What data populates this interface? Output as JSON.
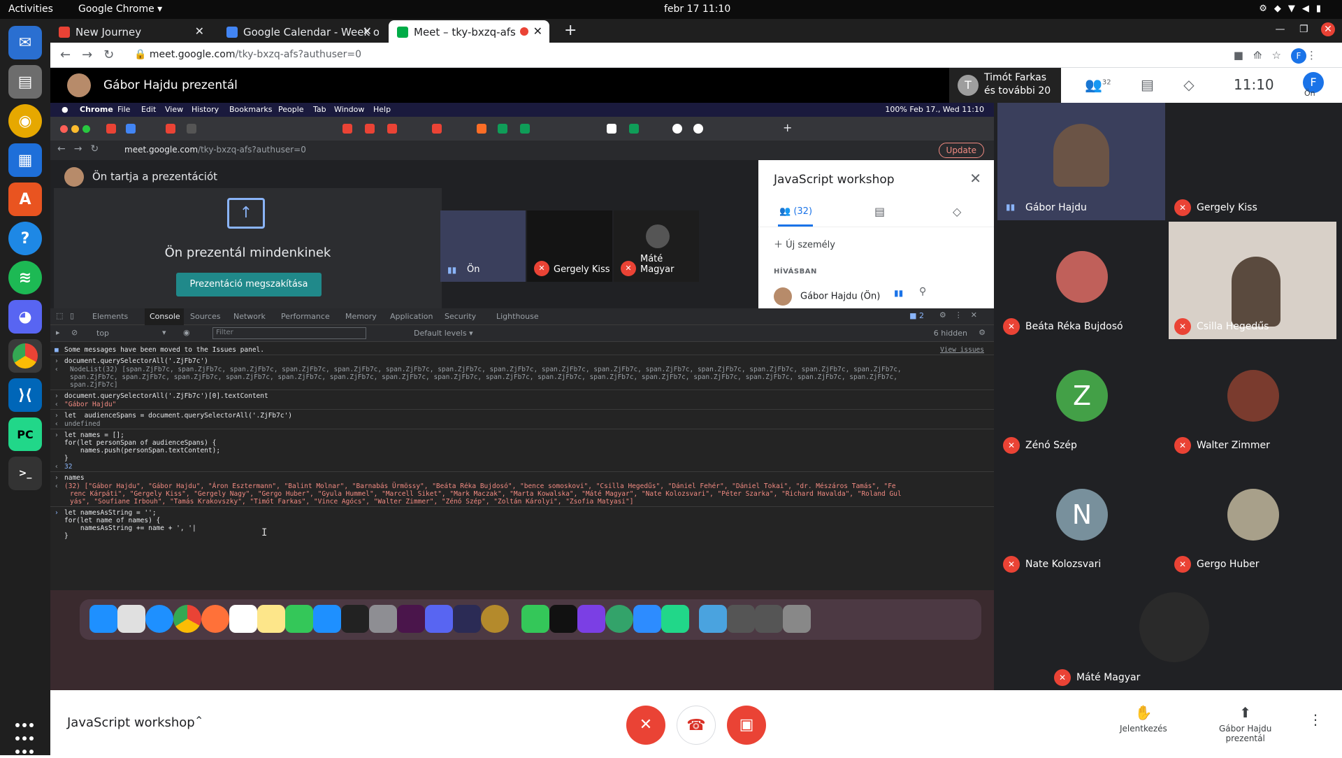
{
  "system": {
    "activities": "Activities",
    "app_name": "Google Chrome ▾",
    "clock": "febr 17  11:10"
  },
  "browser": {
    "tabs": [
      {
        "title": "New Journey",
        "favicon_color": "#e94235"
      },
      {
        "title": "Google Calendar - Week o",
        "favicon_color": "#4285f4"
      },
      {
        "title": "Meet – tky-bxzq-afs",
        "favicon_color": "#00ac47"
      }
    ],
    "url_host": "meet.google.com",
    "url_path": "/tky-bxzq-afs?authuser=0",
    "profile_initial": "F"
  },
  "meet": {
    "presenter_title": "Gábor Hajdu prezentál",
    "presenting_tile_line1": "Timót Farkas",
    "presenting_tile_line2": "és további 20",
    "tile_initial": "T",
    "people_count": "32",
    "time": "11:10",
    "self_label": "Ön",
    "self_initial": "F"
  },
  "shared_screen": {
    "mac_menu": [
      "Chrome",
      "File",
      "Edit",
      "View",
      "History",
      "Bookmarks",
      "People",
      "Tab",
      "Window",
      "Help"
    ],
    "mac_status": "100%   Feb 17., Wed  11:10",
    "inner_url_host": "meet.google.com",
    "inner_url_path": "/tky-bxzq-afs?authuser=0",
    "update_label": "Update",
    "presenting_header": "Ön tartja a prezentációt",
    "presenting_text": "Ön prezentál mindenkinek",
    "stop_button": "Prezentáció megszakítása",
    "tiles": [
      {
        "name": "Ön"
      },
      {
        "name": "Gergely Kiss"
      },
      {
        "name": "Máté Magyar"
      }
    ],
    "panel": {
      "title": "JavaScript workshop",
      "people_tab": "(32)",
      "add_person": "Új személy",
      "section": "HÍVÁSBAN",
      "person": "Gábor Hajdu (Ön)"
    }
  },
  "devtools": {
    "tabs": [
      "Elements",
      "Console",
      "Sources",
      "Network",
      "Performance",
      "Memory",
      "Application",
      "Security",
      "Lighthouse"
    ],
    "issues_count": "2",
    "context": "top",
    "filter_placeholder": "Filter",
    "levels": "Default levels ▾",
    "hidden": "6 hidden",
    "issues_msg": "Some messages have been moved to the Issues panel.",
    "view_issues": "View issues",
    "lines": [
      "document.querySelectorAll('.ZjFb7c')",
      "NodeList(32) [span.ZjFb7c, span.ZjFb7c, span.ZjFb7c, span.ZjFb7c, span.ZjFb7c, span.ZjFb7c, span.ZjFb7c, span.ZjFb7c, span.ZjFb7c, span.ZjFb7c, span.ZjFb7c, span.ZjFb7c, span.ZjFb7c, span.ZjFb7c, span.ZjFb7c,",
      "span.ZjFb7c, span.ZjFb7c, span.ZjFb7c, span.ZjFb7c, span.ZjFb7c, span.ZjFb7c, span.ZjFb7c, span.ZjFb7c, span.ZjFb7c, span.ZjFb7c, span.ZjFb7c, span.ZjFb7c, span.ZjFb7c, span.ZjFb7c, span.ZjFb7c, span.ZjFb7c,",
      "span.ZjFb7c]",
      "document.querySelectorAll('.ZjFb7c')[0].textContent",
      "\"Gábor Hajdu\"",
      "let  audienceSpans = document.querySelectorAll('.ZjFb7c')",
      "undefined",
      "let names = [];",
      "for(let personSpan of audienceSpans) {",
      "    names.push(personSpan.textContent);",
      "}",
      "32",
      "names",
      "(32) [\"Gábor Hajdu\", \"Gábor Hajdu\", \"Áron Esztermann\", \"Balint Molnar\", \"Barnabás Ürmössy\", \"Beáta Réka Bujdosó\", \"bence somoskovi\", \"Csilla Hegedűs\", \"Dániel Fehér\", \"Dániel Tokai\", \"dr. Mészáros Tamás\", \"Fe",
      "renc Kárpáti\", \"Gergely Kiss\", \"Gergely Nagy\", \"Gergo Huber\", \"Gyula Hummel\", \"Marcell Siket\", \"Mark Maczak\", \"Marta Kowalska\", \"Máté Magyar\", \"Nate Kolozsvari\", \"Péter Szarka\", \"Richard Havalda\", \"Roland Gul",
      "yás\", \"Soufiane Irbouh\", \"Tamás Krakovszky\", \"Timót Farkas\", \"Vince Agócs\", \"Walter Zimmer\", \"Zénó Szép\", \"Zoltán Károlyi\", \"Zsofia Matyasi\"]",
      "let namesAsString = '';",
      "for(let name of names) {",
      "    namesAsString += name + ', '|",
      "}"
    ]
  },
  "participants": [
    {
      "name": "Gábor Hajdu",
      "muted": false,
      "type": "video",
      "bg": "#3a3f5c"
    },
    {
      "name": "Gergely Kiss",
      "muted": true,
      "type": "blank",
      "bg": "#202124"
    },
    {
      "name": "Beáta Réka Bujdosó",
      "muted": true,
      "type": "photo",
      "bg": "#202124",
      "avatar_color": "#c0605a"
    },
    {
      "name": "Csilla Hegedűs",
      "muted": true,
      "type": "video",
      "bg": "#d8d0c8"
    },
    {
      "name": "Zénó Szép",
      "muted": true,
      "type": "letter",
      "letter": "Z",
      "avatar_color": "#43a047"
    },
    {
      "name": "Walter Zimmer",
      "muted": true,
      "type": "photo",
      "avatar_color": "#7a3b2e"
    },
    {
      "name": "Nate Kolozsvari",
      "muted": true,
      "type": "letter",
      "letter": "N",
      "avatar_color": "#78909c"
    },
    {
      "name": "Gergo Huber",
      "muted": true,
      "type": "photo",
      "avatar_color": "#a8a08a"
    },
    {
      "name": "Máté Magyar",
      "muted": true,
      "type": "photo",
      "avatar_color": "#2a2a2a"
    }
  ],
  "bottom": {
    "meeting_name": "JavaScript workshop",
    "raise_hand": "Jelentkezés",
    "presenting_line1": "Gábor Hajdu",
    "presenting_line2": "prezentál"
  }
}
